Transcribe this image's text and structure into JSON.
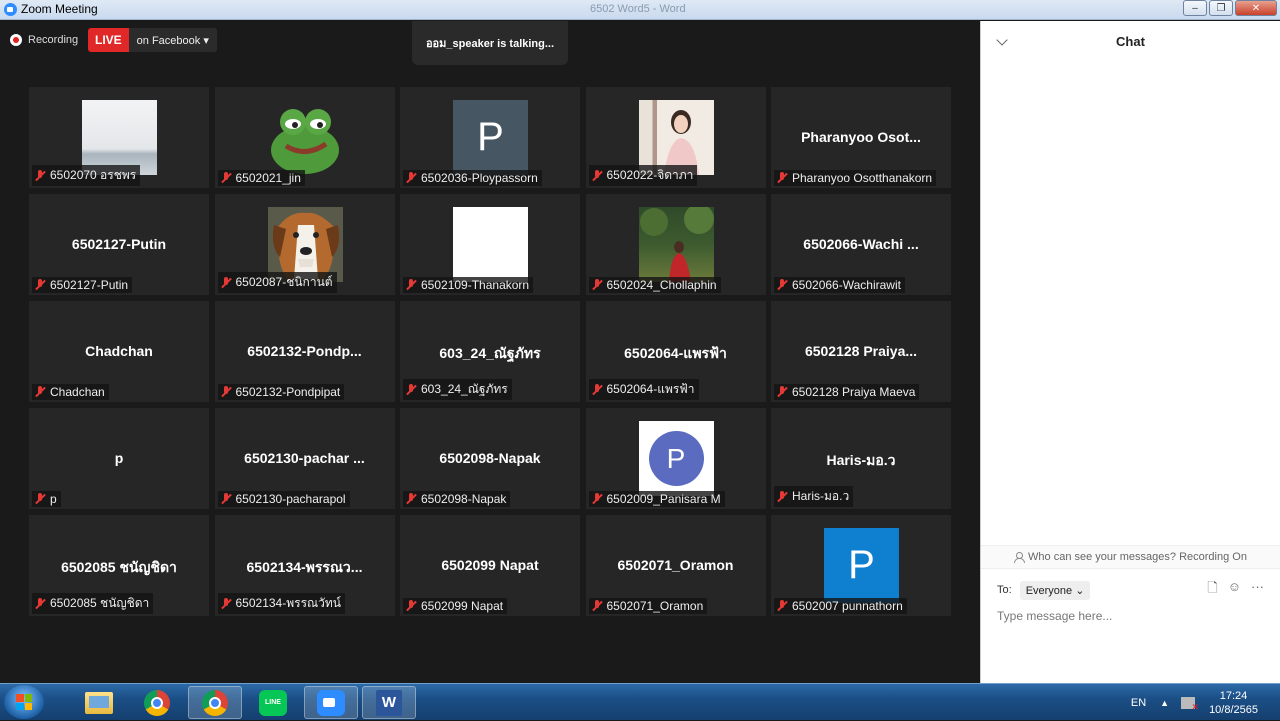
{
  "window": {
    "title": "Zoom Meeting",
    "ghost_title": "6502 Word5 - Word",
    "minimize": "–",
    "maximize": "❐",
    "close": "✕"
  },
  "toolbar": {
    "recording_label": "Recording",
    "live_label": "LIVE",
    "live_target": "on Facebook ▾"
  },
  "speaker_indicator": "ออม_speaker  is  talking...",
  "participants": [
    {
      "display": "",
      "name": "6502070 อรชพร",
      "pic": "sky"
    },
    {
      "display": "",
      "name": "6502021_jin",
      "pic": "frog"
    },
    {
      "display": "",
      "name": "6502036-Ploypassorn",
      "pic": "letter",
      "letter": "P",
      "color": "#465763"
    },
    {
      "display": "",
      "name": "6502022-จิดาภา",
      "pic": "woman"
    },
    {
      "display": "Pharanyoo  Osot...",
      "name": "Pharanyoo Osotthanakorn"
    },
    {
      "display": "6502127-Putin",
      "name": "6502127-Putin"
    },
    {
      "display": "",
      "name": "6502087-ชนิกานต์",
      "pic": "dog"
    },
    {
      "display": "",
      "name": "6502109-Thanakorn",
      "pic": "white"
    },
    {
      "display": "",
      "name": "6502024_Chollaphin",
      "pic": "forest"
    },
    {
      "display": "6502066-Wachi ...",
      "name": "6502066-Wachirawit"
    },
    {
      "display": "Chadchan",
      "name": "Chadchan"
    },
    {
      "display": "6502132-Pondp...",
      "name": "6502132-Pondpipat"
    },
    {
      "display": "603_24_ณัฐภัทร",
      "name": "603_24_ณัฐภัทร"
    },
    {
      "display": "6502064-แพรฟ้า",
      "name": "6502064-แพรฟ้า"
    },
    {
      "display": "6502128 Praiya...",
      "name": "6502128 Praiya Maeva"
    },
    {
      "display": "p",
      "name": "p"
    },
    {
      "display": "6502130-pachar ...",
      "name": "6502130-pacharapol"
    },
    {
      "display": "6502098-Napak",
      "name": "6502098-Napak"
    },
    {
      "display": "",
      "name": "6502009_Panisara M",
      "pic": "circle-letter",
      "letter": "P",
      "color": "#5b6bc0"
    },
    {
      "display": "Haris-มอ.ว",
      "name": "Haris-มอ.ว"
    },
    {
      "display": "6502085 ชนัญชิดา",
      "name": "6502085 ชนัญชิดา"
    },
    {
      "display": "6502134-พรรณว...",
      "name": "6502134-พรรณวัทน์"
    },
    {
      "display": "6502099 Napat",
      "name": "6502099 Napat"
    },
    {
      "display": "6502071_Oramon",
      "name": "6502071_Oramon"
    },
    {
      "display": "",
      "name": "6502007 punnathorn",
      "pic": "letter",
      "letter": "P",
      "color": "#0f7fcf"
    }
  ],
  "chat": {
    "title": "Chat",
    "privacy_notice": "Who can see your messages? Recording On",
    "to_label": "To:",
    "recipient": "Everyone ⌄",
    "placeholder": "Type message here...",
    "file_icon": "🗋",
    "emoji_icon": "☺",
    "more_icon": "···"
  },
  "taskbar": {
    "line_label": "LINE",
    "word_label": "W",
    "language": "EN",
    "tray_arrow": "▲",
    "time": "17:24",
    "date": "10/8/2565"
  },
  "colors": {
    "live": "#e02828",
    "muted_mic": "#e53935",
    "zoom_blue": "#2d8cff"
  }
}
